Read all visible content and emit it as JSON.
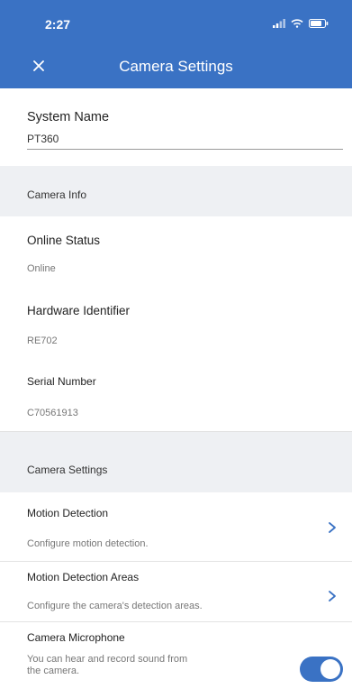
{
  "status_bar": {
    "time": "2:27"
  },
  "header": {
    "title": "Camera Settings"
  },
  "system": {
    "label": "System Name",
    "value": "PT360"
  },
  "camera_info": {
    "header": "Camera Info",
    "online_status": {
      "label": "Online Status",
      "value": "Online"
    },
    "hardware_identifier": {
      "label": "Hardware Identifier",
      "value": "RE702"
    },
    "serial_number": {
      "label": "Serial Number",
      "value": "C70561913"
    }
  },
  "camera_settings": {
    "header": "Camera Settings",
    "motion_detection": {
      "label": "Motion Detection",
      "description": "Configure motion detection."
    },
    "motion_detection_areas": {
      "label": "Motion Detection Areas",
      "description": "Configure the camera's detection areas."
    },
    "camera_microphone": {
      "label": "Camera Microphone",
      "description_line1": "You can hear and record sound from",
      "description_line2": "the camera.",
      "enabled": true
    }
  },
  "colors": {
    "accent": "#3a72c4",
    "section_bg": "#eef0f3"
  }
}
